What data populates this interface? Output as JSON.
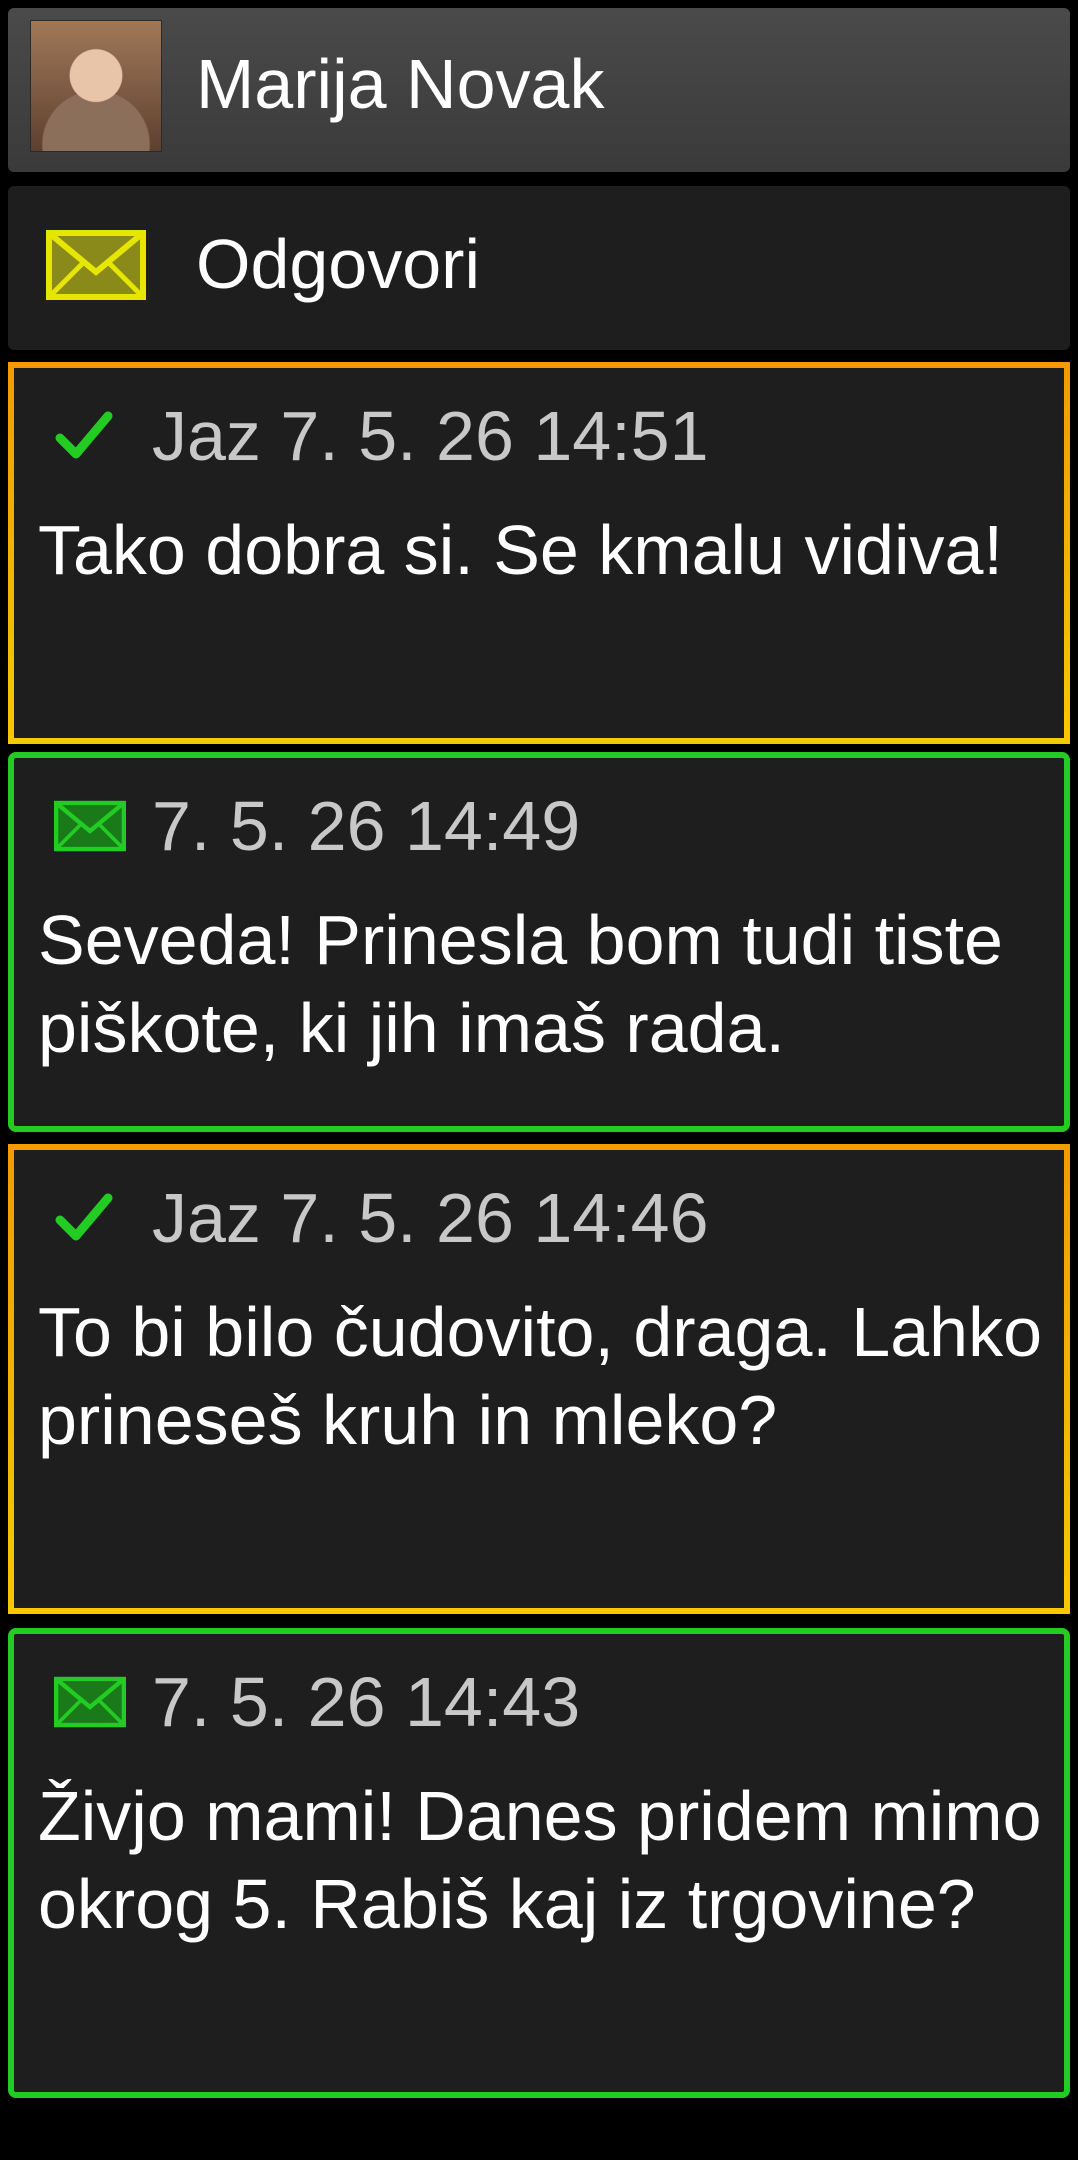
{
  "contact": {
    "name": "Marija Novak",
    "avatar_icon": "contact-photo"
  },
  "reply": {
    "label": "Odgovori",
    "icon": "envelope-icon",
    "icon_color": "#e6e600"
  },
  "colors": {
    "sent_border": "#f5b400",
    "received_border": "#22cc22",
    "check": "#22cc22",
    "received_envelope": "#22cc22"
  },
  "messages": [
    {
      "direction": "sent",
      "status_icon": "check-icon",
      "meta": "Jaz 7. 5. 26 14:51",
      "text": "Tako dobra si. Se kmalu vidiva!"
    },
    {
      "direction": "received",
      "status_icon": "envelope-icon",
      "meta": "7. 5. 26 14:49",
      "text": "Seveda! Prinesla bom tudi tiste piškote, ki jih imaš rada."
    },
    {
      "direction": "sent",
      "status_icon": "check-icon",
      "meta": "Jaz 7. 5. 26 14:46",
      "text": "To bi bilo čudovito, draga. Lahko prineseš kruh in mleko?"
    },
    {
      "direction": "received",
      "status_icon": "envelope-icon",
      "meta": "7. 5. 26 14:43",
      "text": "Živjo mami! Danes pridem mimo okrog 5. Rabiš kaj iz trgovine?"
    }
  ]
}
